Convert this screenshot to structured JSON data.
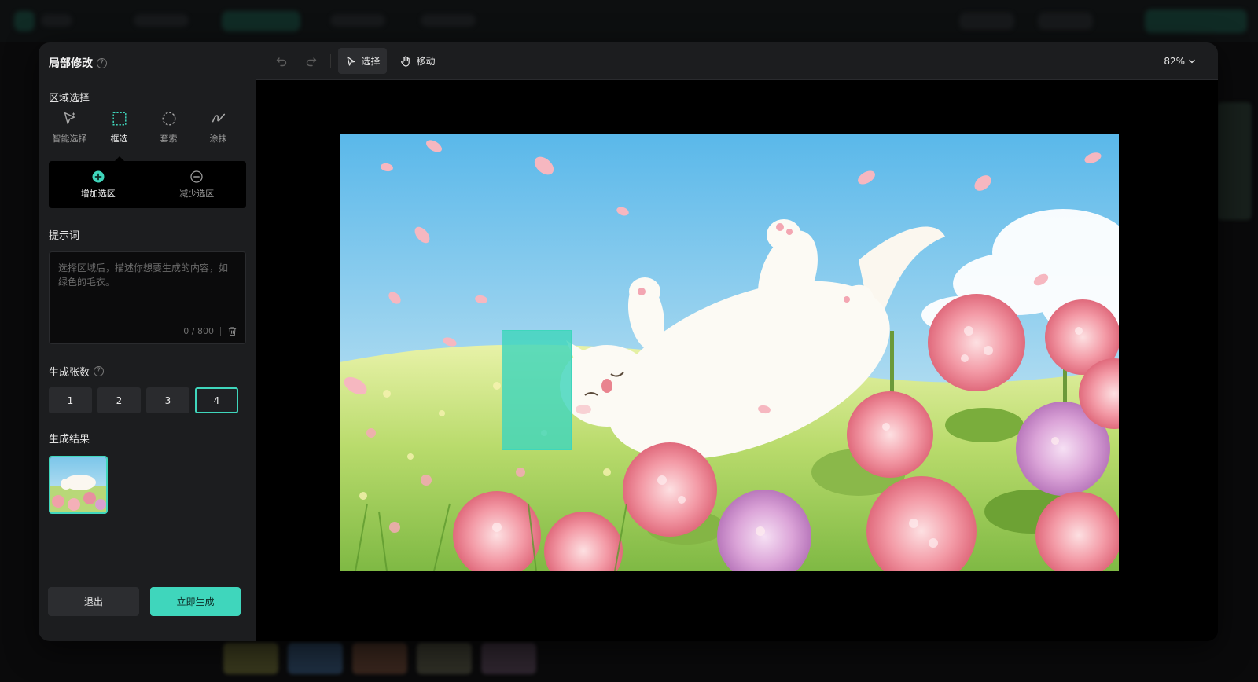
{
  "modal": {
    "title": "局部修改",
    "help_glyph": "?"
  },
  "region": {
    "label": "区域选择",
    "tools": [
      {
        "label": "智能选择",
        "icon": "magic-pointer-icon"
      },
      {
        "label": "框选",
        "icon": "dashed-rect-icon",
        "active": true
      },
      {
        "label": "套索",
        "icon": "lasso-icon"
      },
      {
        "label": "涂抹",
        "icon": "brush-stroke-icon"
      }
    ],
    "modes": [
      {
        "label": "增加选区",
        "icon": "plus-circle-icon",
        "active": true
      },
      {
        "label": "减少选区",
        "icon": "minus-circle-icon"
      }
    ]
  },
  "prompt": {
    "label": "提示词",
    "value": "",
    "placeholder": "选择区域后，描述你想要生成的内容，如绿色的毛衣。",
    "counter": "0 / 800"
  },
  "count": {
    "label": "生成张数",
    "help_glyph": "?",
    "options": [
      "1",
      "2",
      "3",
      "4"
    ],
    "selected": "4"
  },
  "results": {
    "label": "生成结果"
  },
  "actions": {
    "exit": "退出",
    "generate": "立即生成"
  },
  "toolbar": {
    "select": "选择",
    "move": "移动",
    "zoom": "82%"
  },
  "colors": {
    "accent": "#3fd6bc",
    "panel": "#1c1d1f",
    "canvas": "#000000"
  }
}
